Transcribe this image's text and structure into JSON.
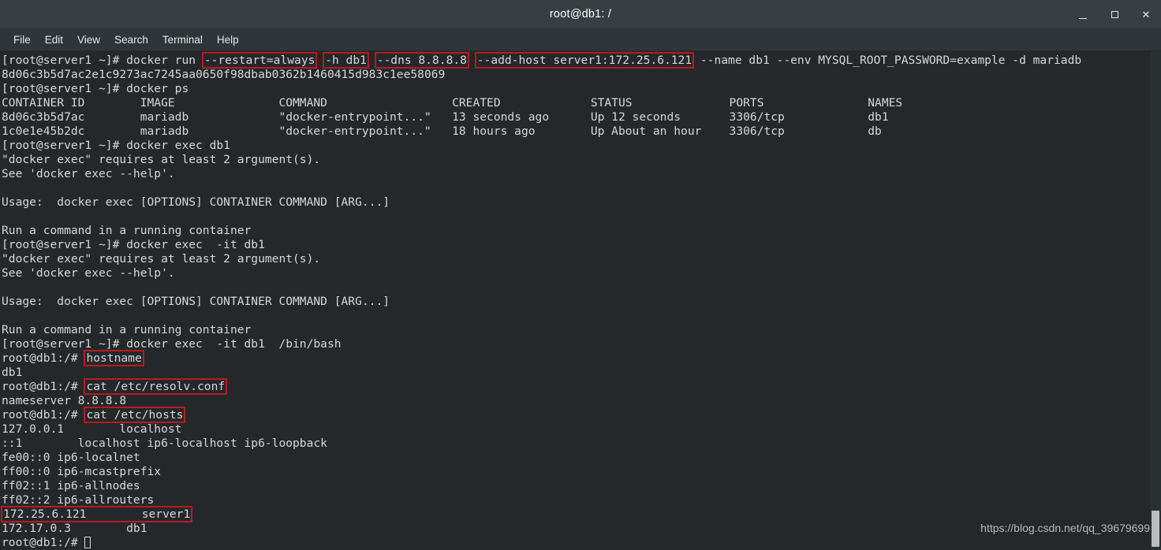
{
  "window": {
    "title": "root@db1: /",
    "controls": [
      {
        "name": "minimize",
        "glyph": ""
      },
      {
        "name": "maximize",
        "glyph": ""
      },
      {
        "name": "close",
        "glyph": "✕"
      }
    ]
  },
  "menubar": {
    "items": [
      {
        "label": "File"
      },
      {
        "label": "Edit"
      },
      {
        "label": "View"
      },
      {
        "label": "Search"
      },
      {
        "label": "Terminal"
      },
      {
        "label": "Help"
      }
    ]
  },
  "terminal": {
    "colors": {
      "background": "#24282a",
      "foreground": "#d6d8d9",
      "highlight_box": "#bb1a1d",
      "titlebar": "#383e42",
      "menubar": "#2f3538"
    },
    "lines": [
      {
        "id": "l01",
        "segments": [
          {
            "text": "[root@server1 ~]# docker run "
          },
          {
            "text": "--restart=always",
            "hl": true
          },
          {
            "text": " "
          },
          {
            "text": "-h db1",
            "hl": true
          },
          {
            "text": " "
          },
          {
            "text": "--dns 8.8.8.8",
            "hl": true
          },
          {
            "text": " "
          },
          {
            "text": "--add-host server1:172.25.6.121",
            "hl": true
          },
          {
            "text": " --name db1 --env MYSQL_ROOT_PASSWORD=example -d mariadb"
          }
        ]
      },
      {
        "id": "l02",
        "segments": [
          {
            "text": "8d06c3b5d7ac2e1c9273ac7245aa0650f98dbab0362b1460415d983c1ee58069"
          }
        ]
      },
      {
        "id": "l03",
        "segments": [
          {
            "text": "[root@server1 ~]# docker ps"
          }
        ]
      },
      {
        "id": "l04",
        "segments": [
          {
            "text": "CONTAINER ID        IMAGE               COMMAND                  CREATED             STATUS              PORTS               NAMES"
          }
        ]
      },
      {
        "id": "l05",
        "segments": [
          {
            "text": "8d06c3b5d7ac        mariadb             \"docker-entrypoint...\"   13 seconds ago      Up 12 seconds       3306/tcp            db1"
          }
        ]
      },
      {
        "id": "l06",
        "segments": [
          {
            "text": "1c0e1e45b2dc        mariadb             \"docker-entrypoint...\"   18 hours ago        Up About an hour    3306/tcp            db"
          }
        ]
      },
      {
        "id": "l07",
        "segments": [
          {
            "text": "[root@server1 ~]# docker exec db1"
          }
        ]
      },
      {
        "id": "l08",
        "segments": [
          {
            "text": "\"docker exec\" requires at least 2 argument(s)."
          }
        ]
      },
      {
        "id": "l09",
        "segments": [
          {
            "text": "See 'docker exec --help'."
          }
        ]
      },
      {
        "id": "l10",
        "segments": [
          {
            "text": ""
          }
        ]
      },
      {
        "id": "l11",
        "segments": [
          {
            "text": "Usage:  docker exec [OPTIONS] CONTAINER COMMAND [ARG...]"
          }
        ]
      },
      {
        "id": "l12",
        "segments": [
          {
            "text": ""
          }
        ]
      },
      {
        "id": "l13",
        "segments": [
          {
            "text": "Run a command in a running container"
          }
        ]
      },
      {
        "id": "l14",
        "segments": [
          {
            "text": "[root@server1 ~]# docker exec  -it db1"
          }
        ]
      },
      {
        "id": "l15",
        "segments": [
          {
            "text": "\"docker exec\" requires at least 2 argument(s)."
          }
        ]
      },
      {
        "id": "l16",
        "segments": [
          {
            "text": "See 'docker exec --help'."
          }
        ]
      },
      {
        "id": "l17",
        "segments": [
          {
            "text": ""
          }
        ]
      },
      {
        "id": "l18",
        "segments": [
          {
            "text": "Usage:  docker exec [OPTIONS] CONTAINER COMMAND [ARG...]"
          }
        ]
      },
      {
        "id": "l19",
        "segments": [
          {
            "text": ""
          }
        ]
      },
      {
        "id": "l20",
        "segments": [
          {
            "text": "Run a command in a running container"
          }
        ]
      },
      {
        "id": "l21",
        "segments": [
          {
            "text": "[root@server1 ~]# docker exec  -it db1  /bin/bash"
          }
        ]
      },
      {
        "id": "l22",
        "segments": [
          {
            "text": "root@db1:/# "
          },
          {
            "text": "hostname",
            "hl": true
          }
        ]
      },
      {
        "id": "l23",
        "segments": [
          {
            "text": "db1"
          }
        ]
      },
      {
        "id": "l24",
        "segments": [
          {
            "text": "root@db1:/# "
          },
          {
            "text": "cat /etc/resolv.conf",
            "hl": true
          }
        ]
      },
      {
        "id": "l25",
        "segments": [
          {
            "text": "nameserver 8.8.8.8"
          }
        ]
      },
      {
        "id": "l26",
        "segments": [
          {
            "text": "root@db1:/# "
          },
          {
            "text": "cat /etc/hosts",
            "hl": true
          }
        ]
      },
      {
        "id": "l27",
        "segments": [
          {
            "text": "127.0.0.1\tlocalhost"
          }
        ]
      },
      {
        "id": "l28",
        "segments": [
          {
            "text": "::1\tlocalhost ip6-localhost ip6-loopback"
          }
        ]
      },
      {
        "id": "l29",
        "segments": [
          {
            "text": "fe00::0 ip6-localnet"
          }
        ]
      },
      {
        "id": "l30",
        "segments": [
          {
            "text": "ff00::0 ip6-mcastprefix"
          }
        ]
      },
      {
        "id": "l31",
        "segments": [
          {
            "text": "ff02::1 ip6-allnodes"
          }
        ]
      },
      {
        "id": "l32",
        "segments": [
          {
            "text": "ff02::2 ip6-allrouters"
          }
        ]
      },
      {
        "id": "l33",
        "segments": [
          {
            "text": "172.25.6.121\tserver1",
            "hl": true
          }
        ]
      },
      {
        "id": "l34",
        "segments": [
          {
            "text": "172.17.0.3\tdb1"
          }
        ]
      },
      {
        "id": "l35",
        "segments": [
          {
            "text": "root@db1:/# "
          },
          {
            "cursor": true
          }
        ]
      }
    ]
  },
  "watermark": {
    "text": "https://blog.csdn.net/qq_39679699"
  },
  "scrollbar": {
    "position": "bottom"
  }
}
